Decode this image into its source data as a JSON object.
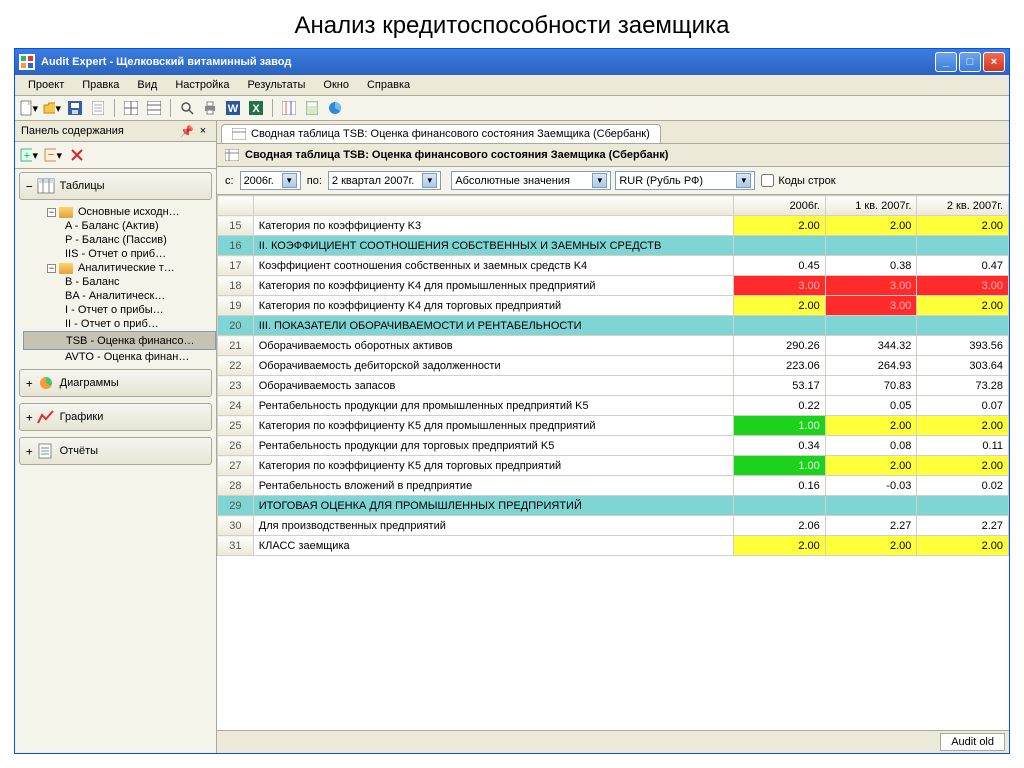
{
  "page_heading": "Анализ кредитоспособности заемщика",
  "window_title": "Audit Expert - Щелковский витаминный завод",
  "menu": [
    "Проект",
    "Правка",
    "Вид",
    "Настройка",
    "Результаты",
    "Окно",
    "Справка"
  ],
  "sidebar": {
    "panel_title": "Панель содержания",
    "sections": {
      "tables": "Таблицы",
      "diagrams": "Диаграммы",
      "graphs": "Графики",
      "reports": "Отчёты"
    },
    "tree": {
      "group1": "Основные исходн…",
      "g1_items": [
        "A - Баланс (Актив)",
        "P - Баланс (Пассив)",
        "IIS - Отчет о приб…"
      ],
      "group2": "Аналитические т…",
      "g2_items": [
        "B - Баланс",
        "BA - Аналитическ…",
        "I - Отчет о прибы…",
        "II - Отчет о приб…",
        "TSB - Оценка финансо…",
        "AVTO - Оценка финан…"
      ]
    }
  },
  "tab_label": "Сводная таблица TSB: Оценка финансового состояния Заемщика (Сбербанк)",
  "doc_title": "Сводная таблица TSB: Оценка финансового состояния Заемщика (Сбербанк)",
  "filters": {
    "from_label": "с:",
    "from_value": "2006г.",
    "to_label": "по:",
    "to_value": "2 квартал 2007г.",
    "abs": "Абсолютные значения",
    "currency": "RUR (Рубль РФ)",
    "codes": "Коды строк"
  },
  "cols": [
    "2006г.",
    "1 кв. 2007г.",
    "2 кв. 2007г."
  ],
  "rows": [
    {
      "n": 15,
      "name": "Категория по коэффициенту K3",
      "v": [
        "2.00",
        "2.00",
        "2.00"
      ],
      "cls": [
        "y",
        "y",
        "y"
      ]
    },
    {
      "n": 16,
      "name": "II. КОЭФФИЦИЕНТ СООТНОШЕНИЯ СОБСТВЕННЫХ И ЗАЕМНЫХ СРЕДСТВ",
      "hdr": true
    },
    {
      "n": 17,
      "name": "Коэффициент соотношения собственных и заемных средств K4",
      "v": [
        "0.45",
        "0.38",
        "0.47"
      ]
    },
    {
      "n": 18,
      "name": "Категория по коэффициенту K4 для промышленных предприятий",
      "v": [
        "3.00",
        "3.00",
        "3.00"
      ],
      "cls": [
        "r",
        "r",
        "r"
      ]
    },
    {
      "n": 19,
      "name": "Категория по коэффициенту K4 для торговых предприятий",
      "v": [
        "2.00",
        "3.00",
        "2.00"
      ],
      "cls": [
        "y",
        "r",
        "y"
      ]
    },
    {
      "n": 20,
      "name": "III. ПОКАЗАТЕЛИ ОБОРАЧИВАЕМОСТИ И РЕНТАБЕЛЬНОСТИ",
      "hdr": true
    },
    {
      "n": 21,
      "name": "Оборачиваемость оборотных активов",
      "v": [
        "290.26",
        "344.32",
        "393.56"
      ]
    },
    {
      "n": 22,
      "name": "Оборачиваемость дебиторской задолженности",
      "v": [
        "223.06",
        "264.93",
        "303.64"
      ]
    },
    {
      "n": 23,
      "name": "Оборачиваемость запасов",
      "v": [
        "53.17",
        "70.83",
        "73.28"
      ]
    },
    {
      "n": 24,
      "name": "Рентабельность продукции для промышленных предприятий K5",
      "v": [
        "0.22",
        "0.05",
        "0.07"
      ]
    },
    {
      "n": 25,
      "name": "Категория по коэффициенту K5 для промышленных предприятий",
      "v": [
        "1.00",
        "2.00",
        "2.00"
      ],
      "cls": [
        "g",
        "y",
        "y"
      ]
    },
    {
      "n": 26,
      "name": "Рентабельность продукции для торговых предприятий K5",
      "v": [
        "0.34",
        "0.08",
        "0.11"
      ]
    },
    {
      "n": 27,
      "name": "Категория по коэффициенту K5 для торговых предприятий",
      "v": [
        "1.00",
        "2.00",
        "2.00"
      ],
      "cls": [
        "g",
        "y",
        "y"
      ]
    },
    {
      "n": 28,
      "name": "Рентабельность вложений в предприятие",
      "v": [
        "0.16",
        "-0.03",
        "0.02"
      ]
    },
    {
      "n": 29,
      "name": "ИТОГОВАЯ ОЦЕНКА ДЛЯ ПРОМЫШЛЕННЫХ ПРЕДПРИЯТИЙ",
      "hdr": true
    },
    {
      "n": 30,
      "name": "Для производственных предприятий",
      "v": [
        "2.06",
        "2.27",
        "2.27"
      ]
    },
    {
      "n": 31,
      "name": "КЛАСС заемщика",
      "v": [
        "2.00",
        "2.00",
        "2.00"
      ],
      "cls": [
        "y",
        "y",
        "y"
      ]
    }
  ],
  "status": "Audit old"
}
